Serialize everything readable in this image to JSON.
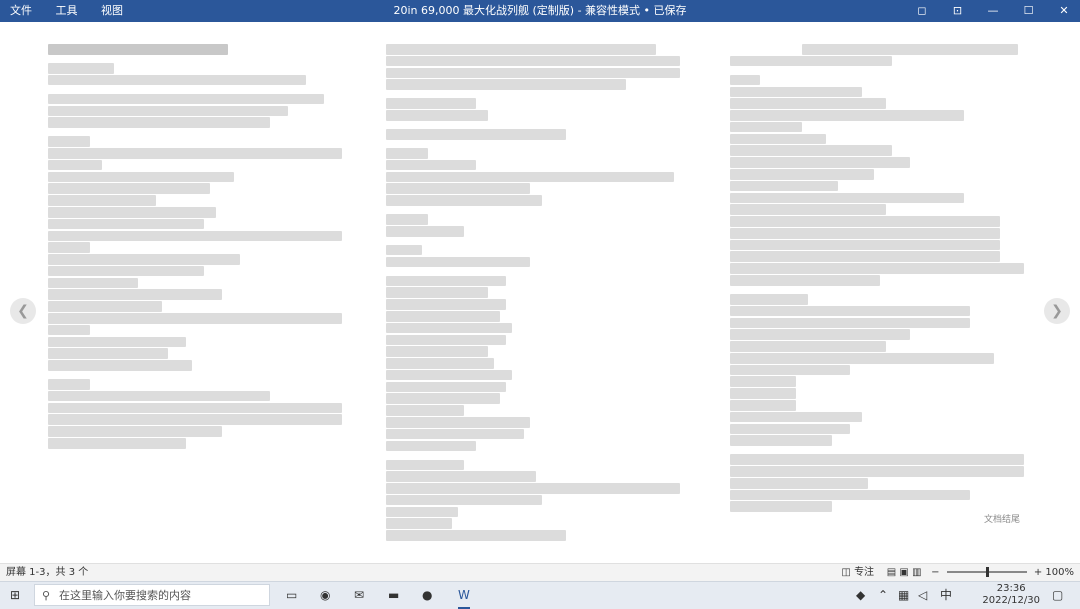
{
  "app": {
    "title": "20in 69,000 最大化战列舰 (定制版) - 兼容性模式 • 已保存",
    "menu": [
      "文件",
      "工具",
      "视图"
    ],
    "window_buttons": [
      "◻︎",
      "⊡",
      "—",
      "☐",
      "✕"
    ]
  },
  "document": {
    "footer_watermark": "文档结尾"
  },
  "status": {
    "pages": "屏幕 1-3，共 3 个",
    "focus": "专注",
    "zoom": "100%",
    "zoom_level": 1.0
  },
  "taskbar": {
    "search_placeholder": "在这里输入你要搜索的内容",
    "clock_time": "23:36",
    "clock_date": "2022/12/30",
    "ime": "中"
  },
  "colors": {
    "title_bg": "#2b579a"
  }
}
